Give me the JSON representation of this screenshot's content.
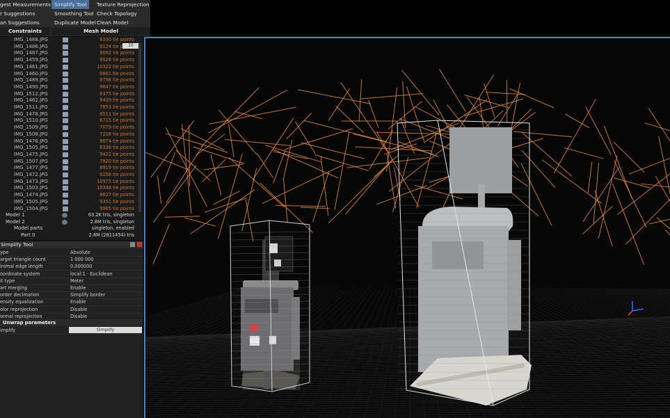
{
  "ribbon": {
    "rows": [
      [
        "gest Measurements",
        "Simplify Tool",
        "Texture Reprojection"
      ],
      [
        "r Suggestions",
        "Smoothing Tool",
        "Check Topology"
      ],
      [
        "an Suggestions",
        "Duplicate Model",
        "Clean Model"
      ]
    ],
    "sections": [
      "Constraints",
      "Mesh Model"
    ]
  },
  "tree": {
    "tooltip": "10",
    "photos": [
      {
        "name": "IMG_1488.JPG",
        "tie": "9330 tie points"
      },
      {
        "name": "IMG_1486.JPG",
        "tie": "9124 tie points"
      },
      {
        "name": "IMG_1487.JPG",
        "tie": "9092 tie points"
      },
      {
        "name": "IMG_1459.JPG",
        "tie": "9526 tie points"
      },
      {
        "name": "IMG_1461.JPG",
        "tie": "10322 tie points"
      },
      {
        "name": "IMG_1460.JPG",
        "tie": "9881 tie points"
      },
      {
        "name": "IMG_1489.JPG",
        "tie": "9798 tie points"
      },
      {
        "name": "IMG_1490.JPG",
        "tie": "9847 tie points"
      },
      {
        "name": "IMG_1512.JPG",
        "tie": "8375 tie points"
      },
      {
        "name": "IMG_1462.JPG",
        "tie": "9439 tie points"
      },
      {
        "name": "IMG_1511.JPG",
        "tie": "7853 tie points"
      },
      {
        "name": "IMG_1478.JPG",
        "tie": "8511 tie points"
      },
      {
        "name": "IMG_1510.JPG",
        "tie": "6715 tie points"
      },
      {
        "name": "IMG_1509.JPG",
        "tie": "7079 tie points"
      },
      {
        "name": "IMG_1508.JPG",
        "tie": "7208 tie points"
      },
      {
        "name": "IMG_1476.JPG",
        "tie": "9674 tie points"
      },
      {
        "name": "IMG_1505.JPG",
        "tie": "8336 tie points"
      },
      {
        "name": "IMG_1475.JPG",
        "tie": "9422 tie points"
      },
      {
        "name": "IMG_1507.JPG",
        "tie": "7820 tie points"
      },
      {
        "name": "IMG_1477.JPG",
        "tie": "8919 tie points"
      },
      {
        "name": "IMG_1472.JPG",
        "tie": "9208 tie points"
      },
      {
        "name": "IMG_1473.JPG",
        "tie": "10975 tie points"
      },
      {
        "name": "IMG_1503.JPG",
        "tie": "10348 tie points"
      },
      {
        "name": "IMG_1474.JPG",
        "tie": "8627 tie points"
      },
      {
        "name": "IMG_1505.JPG",
        "tie": "9351 tie points"
      },
      {
        "name": "IMG_1504.JPG",
        "tie": "9965 tie points"
      }
    ]
  },
  "models": [
    {
      "name": "Model 1",
      "info": "63.2K tris, singleton"
    },
    {
      "name": "Model 2",
      "info": "2.8M tris, singleton"
    },
    {
      "name": "Model parts",
      "info": "singleton, enabled"
    },
    {
      "name": "Part 0",
      "info": "2.8M (2811454) tris"
    }
  ],
  "tool": {
    "title": "Simplify Tool",
    "params": [
      {
        "key": "ype",
        "value": "Absolute"
      },
      {
        "key": "arget triangle count",
        "value": "1 000 000"
      },
      {
        "key": "inimal edge length",
        "value": "0.000000"
      },
      {
        "key": "oordinate system",
        "value": "local:1 - Euclidean"
      },
      {
        "key": "it type",
        "value": "Meter"
      },
      {
        "key": "art merging",
        "value": "Enable"
      },
      {
        "key": "order decimation",
        "value": "Simplify border"
      },
      {
        "key": "ensity equalization",
        "value": "Enable"
      },
      {
        "key": "olor reprojection",
        "value": "Disable"
      },
      {
        "key": "ormal reprojection",
        "value": "Disable"
      }
    ],
    "section": "Unwrap parameters",
    "action_key": "implify",
    "action_label": "Simplify"
  },
  "colors": {
    "accent": "#4d82c4",
    "camera_lines": "#e08a4a",
    "tie_points": "#c9792f"
  }
}
